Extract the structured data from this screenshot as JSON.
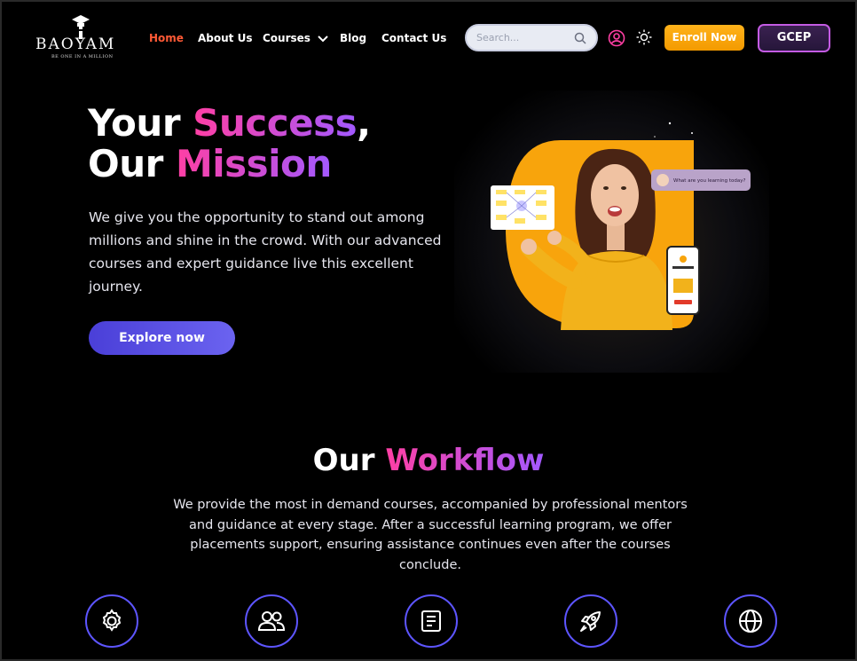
{
  "logo": {
    "word": "BAOYAM",
    "tagline": "BE ONE IN A MILLION"
  },
  "nav": {
    "items": [
      {
        "label": "Home",
        "active": true
      },
      {
        "label": "About Us"
      },
      {
        "label": "Courses"
      },
      {
        "label": "Blog"
      },
      {
        "label": "Contact Us"
      }
    ],
    "search_placeholder": "Search...",
    "enroll_label": "Enroll Now",
    "gcep_label": "GCEP"
  },
  "hero": {
    "title_line1_a": "Your ",
    "title_line1_b": "Success",
    "title_line1_c": ",",
    "title_line2_a": "Our ",
    "title_line2_b": "Mission",
    "description": "We give you the opportunity to stand out among millions and shine in the crowd. With our advanced courses and expert guidance live this excellent journey.",
    "cta": "Explore now",
    "chat_bubble": "What are you learning today?"
  },
  "workflow": {
    "title_a": "Our ",
    "title_b": "Workflow",
    "description": "We provide the most in demand courses, accompanied by professional mentors and guidance at every stage. After a successful learning program, we offer placements support, ensuring assistance continues even after the courses conclude.",
    "icons": [
      "gear-icon",
      "users-icon",
      "document-icon",
      "rocket-icon",
      "globe-icon"
    ]
  },
  "colors": {
    "accent_orange": "#ff5a36",
    "enroll": "#f5a300",
    "purple": "#5d55ff",
    "pink": "#ff3fa4"
  }
}
